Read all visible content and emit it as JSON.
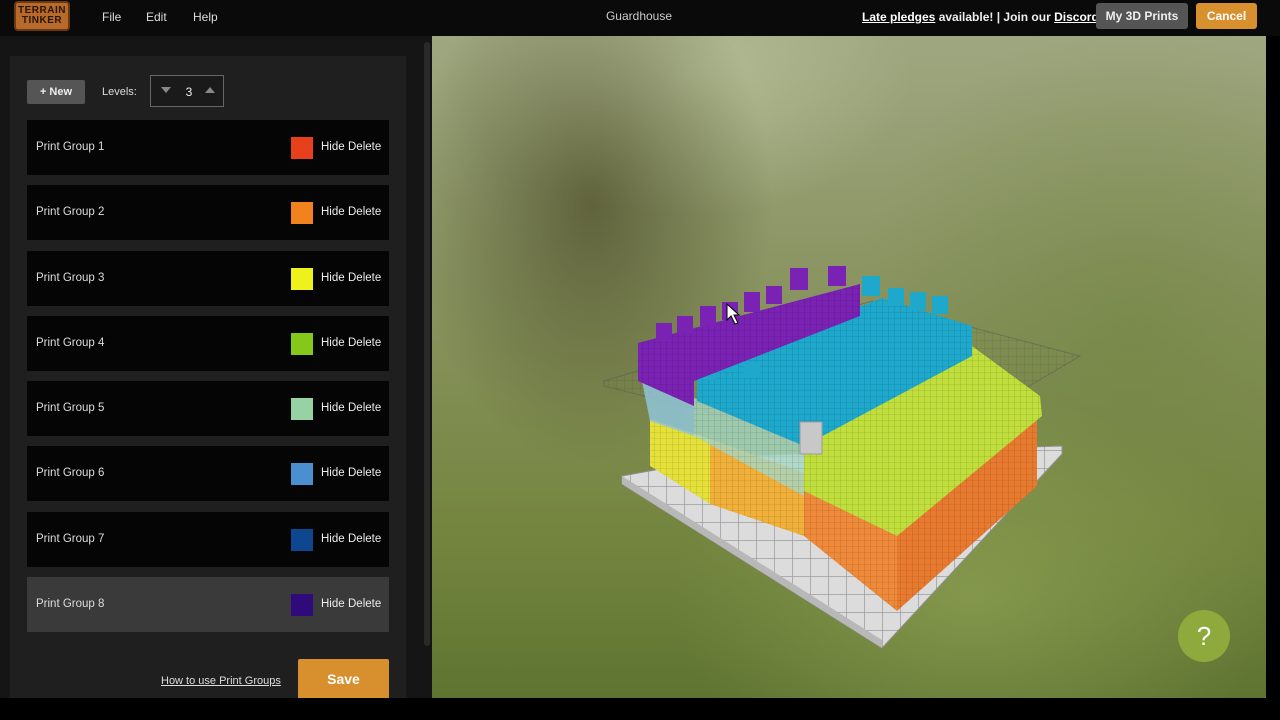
{
  "app": {
    "logo_line1": "TERRAIN",
    "logo_line2": "TINKER",
    "document_title": "Guardhouse"
  },
  "menu": {
    "file": "File",
    "edit": "Edit",
    "help": "Help"
  },
  "header": {
    "late_pledges_link": "Late pledges",
    "available_text": " available! | Join our ",
    "discord_link": "Discord",
    "my_prints_button": "My 3D Prints",
    "cancel_button": "Cancel"
  },
  "toolbar": {
    "new_button": "+ New",
    "levels_label": "Levels:",
    "levels_value": "3"
  },
  "print_groups": [
    {
      "name": "Print Group 1",
      "color": "#e8401c",
      "hide": "Hide",
      "delete": "Delete"
    },
    {
      "name": "Print Group 2",
      "color": "#f2821e",
      "hide": "Hide",
      "delete": "Delete"
    },
    {
      "name": "Print Group 3",
      "color": "#eef21a",
      "hide": "Hide",
      "delete": "Delete"
    },
    {
      "name": "Print Group 4",
      "color": "#86c81a",
      "hide": "Hide",
      "delete": "Delete"
    },
    {
      "name": "Print Group 5",
      "color": "#96d2a4",
      "hide": "Hide",
      "delete": "Delete"
    },
    {
      "name": "Print Group 6",
      "color": "#4a90d0",
      "hide": "Hide",
      "delete": "Delete"
    },
    {
      "name": "Print Group 7",
      "color": "#0f4690",
      "hide": "Hide",
      "delete": "Delete"
    },
    {
      "name": "Print Group 8",
      "color": "#2e0a7a",
      "hide": "Hide",
      "delete": "Delete",
      "selected": true
    }
  ],
  "footer": {
    "howto_link": "How to use Print Groups",
    "save_button": "Save"
  },
  "help_button": "?",
  "colors": {
    "accent": "#d8902e",
    "base_tiles": "#d8d8d8",
    "purple_walls": "#7a20b0",
    "cyan_walls": "#1aa0c8"
  }
}
